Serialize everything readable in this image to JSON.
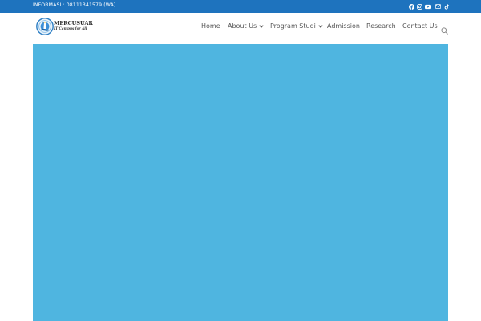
{
  "topbar": {
    "info_text": "INFORMASI : 08111341579 (WA)",
    "social_icons": [
      "facebook-icon",
      "instagram-icon",
      "youtube-icon",
      "email-icon",
      "tiktok-icon"
    ],
    "background_color": "#1e73be"
  },
  "header": {
    "logo": {
      "name": "MERCUSUAR",
      "tagline": "IT Campus for All"
    },
    "nav": {
      "home": "Home",
      "about": "About Us",
      "program": "Program Studi",
      "admission": "Admission",
      "research": "Research",
      "contact": "Contact Us"
    }
  },
  "hero": {
    "background_color": "#4fb5e0"
  }
}
